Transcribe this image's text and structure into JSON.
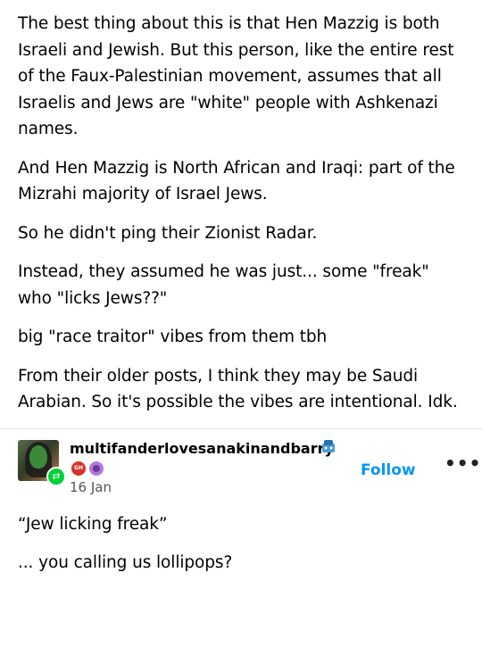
{
  "post": {
    "paragraphs": [
      "The best thing about this is that Hen Mazzig is both Israeli and Jewish. But this person, like the entire rest of the Faux-Palestinian movement, assumes that all Israelis and Jews are \"white\" people with Ashkenazi names.",
      "And Hen Mazzig is North African and Iraqi: part of the Mizrahi majority of Israel Jews.",
      "So he didn't ping their Zionist Radar.",
      "Instead, they assumed he was just... some \"freak\" who \"licks Jews??\"",
      "big \"race traitor\" vibes from them tbh",
      "From their older posts, I think they may be Saudi Arabian. So it's possible the vibes are intentional. Idk."
    ]
  },
  "reblog": {
    "username": "multifanderlovesanakinandbarry",
    "date": "16 Jan",
    "follow_label": "Follow",
    "more_label": "•••",
    "badge1_text": "GH",
    "paragraphs": [
      "“Jew licking freak”",
      "... you calling us lollipops?"
    ]
  },
  "icons": {
    "reblog": "reblog-icon",
    "more": "more-options-icon"
  },
  "colors": {
    "follow": "#0095ff",
    "reblog_badge": "#00cf35"
  }
}
